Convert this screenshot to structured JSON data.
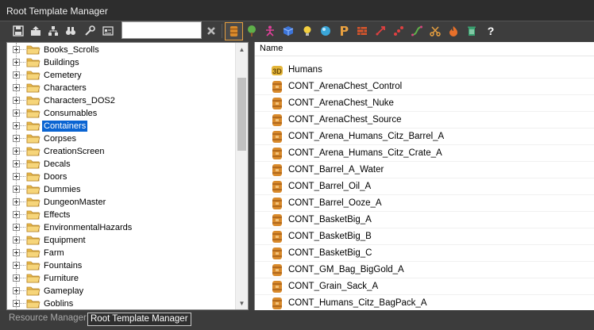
{
  "window": {
    "title": "Root Template Manager"
  },
  "toolbar": {
    "search_value": "",
    "tools": [
      "save-icon",
      "export-icon",
      "hierarchy-icon",
      "binoculars-icon",
      "wrench-icon",
      "properties-icon"
    ],
    "clear_icon": "clear-icon",
    "filters": [
      "container-filter-icon",
      "tree-filter-icon",
      "character-filter-icon",
      "item-filter-icon",
      "light-filter-icon",
      "trigger-filter-icon",
      "decal-filter-icon",
      "wall-filter-icon",
      "projectile-filter-icon",
      "surface-filter-icon",
      "spline-filter-icon",
      "scissors-filter-icon",
      "fire-filter-icon",
      "trash-filter-icon"
    ],
    "help_label": "?"
  },
  "tree": {
    "items": [
      {
        "label": "Books_Scrolls"
      },
      {
        "label": "Buildings"
      },
      {
        "label": "Cemetery"
      },
      {
        "label": "Characters"
      },
      {
        "label": "Characters_DOS2"
      },
      {
        "label": "Consumables"
      },
      {
        "label": "Containers",
        "selected": true
      },
      {
        "label": "Corpses"
      },
      {
        "label": "CreationScreen"
      },
      {
        "label": "Decals"
      },
      {
        "label": "Doors"
      },
      {
        "label": "Dummies"
      },
      {
        "label": "DungeonMaster"
      },
      {
        "label": "Effects"
      },
      {
        "label": "EnvironmentalHazards"
      },
      {
        "label": "Equipment"
      },
      {
        "label": "Farm"
      },
      {
        "label": "Fountains"
      },
      {
        "label": "Furniture"
      },
      {
        "label": "Gameplay"
      },
      {
        "label": "Goblins"
      }
    ]
  },
  "list": {
    "column_name": "Name",
    "rows": [
      {
        "label": "Humans",
        "icon": "humans-icon"
      },
      {
        "label": "CONT_ArenaChest_Control",
        "icon": "barrel-icon"
      },
      {
        "label": "CONT_ArenaChest_Nuke",
        "icon": "barrel-icon"
      },
      {
        "label": "CONT_ArenaChest_Source",
        "icon": "barrel-icon"
      },
      {
        "label": "CONT_Arena_Humans_Citz_Barrel_A",
        "icon": "barrel-icon"
      },
      {
        "label": "CONT_Arena_Humans_Citz_Crate_A",
        "icon": "barrel-icon"
      },
      {
        "label": "CONT_Barrel_A_Water",
        "icon": "barrel-icon"
      },
      {
        "label": "CONT_Barrel_Oil_A",
        "icon": "barrel-icon"
      },
      {
        "label": "CONT_Barrel_Ooze_A",
        "icon": "barrel-icon"
      },
      {
        "label": "CONT_BasketBig_A",
        "icon": "barrel-icon"
      },
      {
        "label": "CONT_BasketBig_B",
        "icon": "barrel-icon"
      },
      {
        "label": "CONT_BasketBig_C",
        "icon": "barrel-icon"
      },
      {
        "label": "CONT_GM_Bag_BigGold_A",
        "icon": "barrel-icon"
      },
      {
        "label": "CONT_Grain_Sack_A",
        "icon": "barrel-icon"
      },
      {
        "label": "CONT_Humans_Citz_BagPack_A",
        "icon": "barrel-icon"
      }
    ]
  },
  "statusbar": {
    "tabs": [
      {
        "label": "Resource Manager",
        "active": false
      },
      {
        "label": "Root Template Manager",
        "active": true
      }
    ]
  },
  "colors": {
    "selection": "#0a64d2",
    "folder": "#f0c050",
    "barrel": "#d98a2b",
    "accent": "#e8a040"
  }
}
